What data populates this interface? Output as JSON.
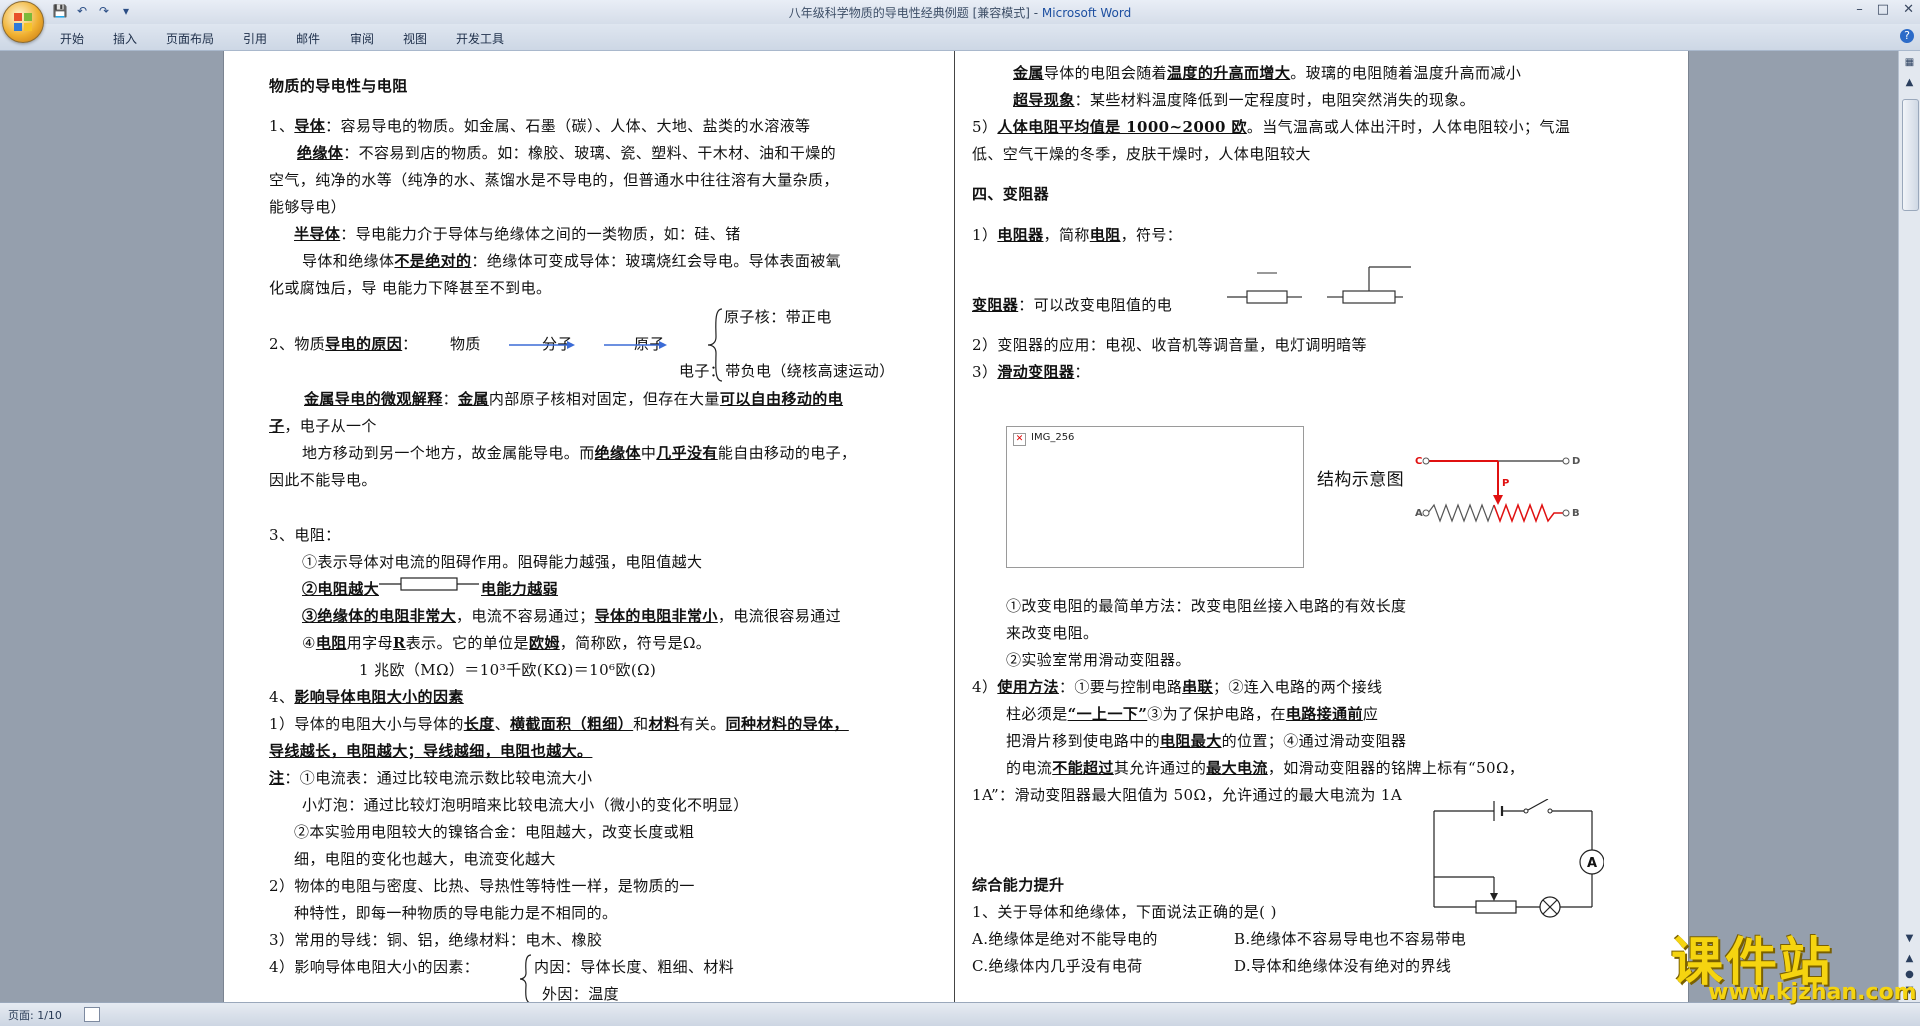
{
  "window": {
    "title_doc": "八年级科学物质的导电性经典例题 [兼容模式] - ",
    "title_app": "Microsoft Word"
  },
  "ribbon": {
    "tabs": [
      "开始",
      "插入",
      "页面布局",
      "引用",
      "邮件",
      "审阅",
      "视图",
      "开发工具"
    ]
  },
  "status": {
    "page": "页面: 1/10"
  },
  "watermark": {
    "brand": "课件站",
    "url": "www.kjzhan.com",
    "color": "#f5d410"
  },
  "left_col": {
    "title": "物质的导电性与电阻",
    "s1_num": "1、",
    "s1_key": "导体",
    "s1_text": "：容易导电的物质。如金属、石墨（碳）、人体、大地、盐类的水溶液等",
    "s1_ins_key": "绝缘体",
    "s1_ins_text": "：不容易到店的物质。如：橡胶、玻璃、瓷、塑料、干木材、油和干燥的",
    "s1_ins_l2": "空气，纯净的水等（纯净的水、蒸馏水是不导电的，但普通水中往往溶有大量杂质，",
    "s1_ins_l3": "能够导电）",
    "s1_semi_key": "半导体",
    "s1_semi_text": "：导电能力介于导体与绝缘体之间的一类物质，如：硅、锗",
    "s1_conv_pre": "导体和绝缘体",
    "s1_conv_key": "不是绝对的",
    "s1_conv_text": "：绝缘体可变成导体：玻璃烧红会导电。导体表面被氧",
    "s1_conv_l2": "化或腐蚀后，导  电能力下降甚至不到电。",
    "s2_num": "2、物质",
    "s2_key": "导电的原因",
    "s2_colon": "：",
    "s2_matter": "物质",
    "s2_molecule": "分子",
    "s2_atom": "原子",
    "s2_nucleus": "原子核：带正电",
    "s2_electron": "电子：带负电（绕核高速运动）",
    "s2_micro_key": "金属导电的微观解释",
    "s2_micro_colon": "：",
    "s2_metal": "金属",
    "s2_micro_text": "内部原子核相对固定，但存在大量",
    "s2_micro_key2": "可以自由移动的电",
    "s2_micro_l2_key": "子",
    "s2_micro_l2": "，电子从一个",
    "s2_micro_l3_pre": "地方移动到另一个地方，故金属能导电。而",
    "s2_micro_l3_key1": "绝缘体",
    "s2_micro_l3_mid": "中",
    "s2_micro_l3_key2": "几乎没有",
    "s2_micro_l3_post": "能自由移动的电子，",
    "s2_micro_l4": "因此不能导电。",
    "s3_head": "3、电阻：",
    "s3_1": "①表示导体对电流的阻碍作用。阻碍能力越强，电阻值越大",
    "s3_2_key": "②电阻越大",
    "s3_2_key2": "电能力越弱",
    "s3_3_key1": "③绝缘体的电阻非常大",
    "s3_3_mid": "，电流不容易通过；",
    "s3_3_key2": "导体的电阻非常小",
    "s3_3_post": "，电流很容易通过",
    "s3_4_pre": "④",
    "s3_4_key1": "电阻",
    "s3_4_mid": "用字母",
    "s3_4_R": "R",
    "s3_4_mid2": "表示。它的单位是",
    "s3_4_key2": "欧姆",
    "s3_4_post": "，简称欧，符号是Ω。",
    "s3_units": "1 兆欧（MΩ）＝10³千欧(KΩ)＝10⁶欧(Ω)",
    "s4_num": "4、",
    "s4_key": "影响导体电阻大小的因素",
    "s4_1_pre": "1）导体的电阻大小与导体的",
    "s4_1_k1": "长度",
    "s4_1_k2": "横截面积（粗细）",
    "s4_1_and": "和",
    "s4_1_k3": "材料",
    "s4_1_mid": "有关。",
    "s4_1_k4": "同种材料的导体，",
    "s4_1_l2": "导线越长，电阻越大；导线越细，电阻也越大。",
    "note_key": "注",
    "note_1": "：①电流表：通过比较电流示数比较电流大小",
    "note_2": "小灯泡：通过比较灯泡明暗来比较电流大小（微小的变化不明显）",
    "note_3": "②本实验用电阻较大的镍铬合金：电阻越大，改变长度或粗",
    "note_4": "细，电阻的变化也越大，电流变化越大",
    "s4_2": "2）物体的电阻与密度、比热、导热性等特性一样，是物质的一",
    "s4_2b": "种特性，即每一种物质的导电能力是不相同的。",
    "s4_3": "3）常用的导线：铜、铝，绝缘材料：电木、橡胶",
    "s4_4": "4）影响导体电阻大小的因素：",
    "s4_4_in": "内因：导体长度、粗细、材料",
    "s4_4_out": "外因：温度"
  },
  "right_col": {
    "t1_key": "金属",
    "t1_mid": "导体的电阻会随着",
    "t1_key2": "温度的升高而增大",
    "t1_post": "。玻璃的电阻随着温度升高而减小",
    "sc_key": "超导现象",
    "sc_text": "：某些材料温度降低到一定程度时，电阻突然消失的现象。",
    "t5_pre": "5）",
    "t5_key": "人体电阻平均值是 1000~2000 欧",
    "t5_post": "。当气温高或人体出汗时，人体电阻较小；气温",
    "t5_l2": "低、空气干燥的冬季，皮肤干燥时，人体电阻较大",
    "s4_head": "四、变阻器",
    "r1_pre": "1）",
    "r1_key1": "电阻器",
    "r1_mid": "，简称",
    "r1_key2": "电阻",
    "r1_post": "，符号：",
    "var_key": "变阻器",
    "var_text": "：可以改变电阻值的电",
    "r2": "2）变阻器的应用：电视、收音机等调音量，电灯调明暗等",
    "r3_pre": "3）",
    "r3_key": "滑动变阻器",
    "r3_post": "：",
    "img_name": "IMG_256",
    "struct_label": "结构示意图",
    "lbl_C": "C",
    "lbl_D": "D",
    "lbl_A": "A",
    "lbl_B": "B",
    "lbl_P": "P",
    "m1": "①改变电阻的最简单方法：改变电阻丝接入电路的有效长度",
    "m1b": "来改变电阻。",
    "m2": "②实验室常用滑动变阻器。",
    "r4_pre": "4）",
    "r4_key": "使用方法",
    "r4_text": "：①要与控制电路",
    "r4_key2": "串联",
    "r4_text2": "；②连入电路的两个接线",
    "r4_l2_pre": "柱必须是",
    "r4_l2_key": "“一上一下”",
    "r4_l2_mid": "③为了保护电路，在",
    "r4_l2_key2": "电路接通前",
    "r4_l2_post": "应",
    "r4_l3_pre": "把滑片移到使电路中的",
    "r4_l3_key": "电阻最大",
    "r4_l3_post": "的位置；④通过滑动变阻器",
    "r4_l4_pre": "的电流",
    "r4_l4_key": "不能超过",
    "r4_l4_mid": "其允许通过的",
    "r4_l4_key2": "最大电流",
    "r4_l4_post": "，如滑动变阻器的铭牌上标有“50Ω，",
    "r4_l5": "1A”：滑动变阻器最大阻值为 50Ω，允许通过的最大电流为 1A",
    "lbl_ammeter": "A",
    "ex_head": "综合能力提升",
    "q1": "1、关于导体和绝缘体，下面说法正确的是(      )",
    "qA": "A.绝缘体是绝对不能导电的",
    "qB": "B.绝缘体不容易导电也不容易带电",
    "qC": "C.绝缘体内几乎没有电荷",
    "qD": "D.导体和绝缘体没有绝对的界线"
  }
}
